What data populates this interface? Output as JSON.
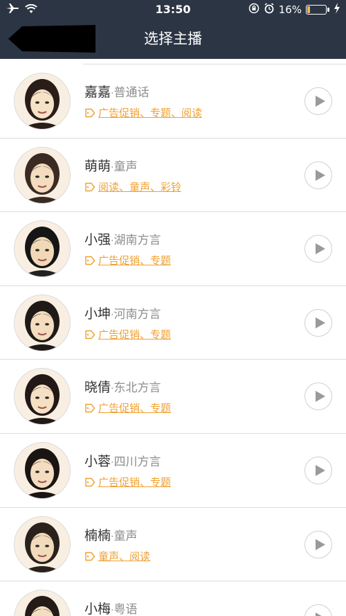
{
  "status_bar": {
    "time": "13:50",
    "battery_text": "16%",
    "battery_level": 0.16,
    "icons": [
      "airplane-icon",
      "wifi-icon",
      "rotation-lock-icon",
      "alarm-icon",
      "charging-icon"
    ]
  },
  "header": {
    "title": "选择主播",
    "back_icon": "back-arrow-icon"
  },
  "colors": {
    "header_bg": "#2c3544",
    "tag_orange": "#f0a030",
    "battery_fill": "#f4b55b"
  },
  "anchors": [
    {
      "name": "嘉嘉",
      "sep": "·",
      "dialect": "普通话",
      "tags": "广告促销、专题、阅读"
    },
    {
      "name": "萌萌",
      "sep": "·",
      "dialect": "童声",
      "tags": "阅读、童声、彩铃"
    },
    {
      "name": "小强",
      "sep": "·",
      "dialect": "湖南方言",
      "tags": "广告促销、专题"
    },
    {
      "name": "小坤",
      "sep": "·",
      "dialect": "河南方言",
      "tags": "广告促销、专题"
    },
    {
      "name": "晓倩",
      "sep": "·",
      "dialect": "东北方言",
      "tags": "广告促销、专题"
    },
    {
      "name": "小蓉",
      "sep": "·",
      "dialect": "四川方言",
      "tags": "广告促销、专题"
    },
    {
      "name": "楠楠",
      "sep": "·",
      "dialect": "童声",
      "tags": "童声、阅读"
    },
    {
      "name": "小梅",
      "sep": "·",
      "dialect": "粤语",
      "tags": ""
    }
  ]
}
